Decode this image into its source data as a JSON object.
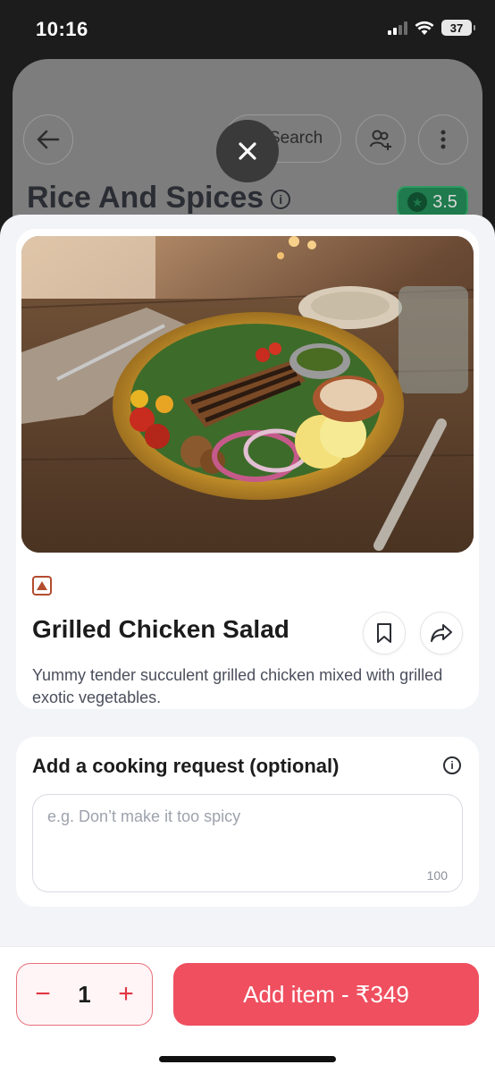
{
  "status_bar": {
    "time": "10:16",
    "battery": "37"
  },
  "background": {
    "search_label": "Search",
    "restaurant_name": "Rice And Spices",
    "info_glyph": "i",
    "rating": "3.5"
  },
  "dish": {
    "name": "Grilled Chicken Salad",
    "description": "Yummy tender succulent grilled chicken mixed with grilled exotic vegetables.",
    "veg_mark": "non-veg-triangle"
  },
  "cooking_request": {
    "title": "Add a cooking request (optional)",
    "info_glyph": "i",
    "placeholder": "e.g. Don’t make it too spicy",
    "char_limit": "100"
  },
  "cart": {
    "decrement": "−",
    "quantity": "1",
    "increment": "+",
    "add_label": "Add item - ₹349"
  },
  "colors": {
    "accent": "#ef4f5f",
    "accent_border": "#e8707c",
    "rating_green": "#1f7a4d",
    "nonveg_marker": "#b34c2f"
  }
}
